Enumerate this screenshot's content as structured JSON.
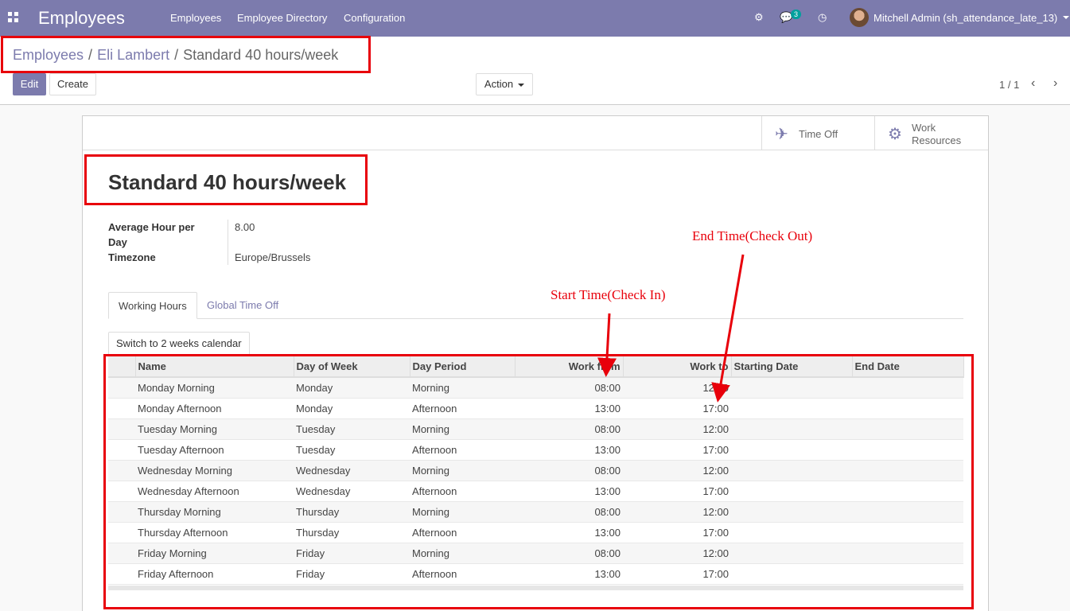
{
  "navbar": {
    "app_title": "Employees",
    "menu": [
      "Employees",
      "Employee Directory",
      "Configuration"
    ],
    "message_count": "3",
    "user": "Mitchell Admin (sh_attendance_late_13)"
  },
  "breadcrumb": {
    "items": [
      "Employees",
      "Eli Lambert"
    ],
    "current": "Standard 40 hours/week"
  },
  "buttons": {
    "edit": "Edit",
    "create": "Create",
    "action": "Action"
  },
  "pager": {
    "value": "1 / 1"
  },
  "smart_buttons": {
    "time_off": "Time Off",
    "work_resources_line1": "Work",
    "work_resources_line2": "Resources"
  },
  "form": {
    "title": "Standard 40 hours/week",
    "avg_hour_label_line1": "Average Hour per",
    "avg_hour_label_line2": "Day",
    "avg_hour_value": "8.00",
    "timezone_label": "Timezone",
    "timezone_value": "Europe/Brussels"
  },
  "tabs": [
    "Working Hours",
    "Global Time Off"
  ],
  "switch_button": "Switch to 2 weeks calendar",
  "table": {
    "columns": [
      "Name",
      "Day of Week",
      "Day Period",
      "Work from",
      "Work to",
      "Starting Date",
      "End Date"
    ],
    "rows": [
      [
        "Monday Morning",
        "Monday",
        "Morning",
        "08:00",
        "12:00"
      ],
      [
        "Monday Afternoon",
        "Monday",
        "Afternoon",
        "13:00",
        "17:00"
      ],
      [
        "Tuesday Morning",
        "Tuesday",
        "Morning",
        "08:00",
        "12:00"
      ],
      [
        "Tuesday Afternoon",
        "Tuesday",
        "Afternoon",
        "13:00",
        "17:00"
      ],
      [
        "Wednesday Morning",
        "Wednesday",
        "Morning",
        "08:00",
        "12:00"
      ],
      [
        "Wednesday Afternoon",
        "Wednesday",
        "Afternoon",
        "13:00",
        "17:00"
      ],
      [
        "Thursday Morning",
        "Thursday",
        "Morning",
        "08:00",
        "12:00"
      ],
      [
        "Thursday Afternoon",
        "Thursday",
        "Afternoon",
        "13:00",
        "17:00"
      ],
      [
        "Friday Morning",
        "Friday",
        "Morning",
        "08:00",
        "12:00"
      ],
      [
        "Friday Afternoon",
        "Friday",
        "Afternoon",
        "13:00",
        "17:00"
      ]
    ]
  },
  "annotations": {
    "start_time": "Start Time(Check In)",
    "end_time": "End Time(Check Out)",
    "color": "#e8000b"
  },
  "colors": {
    "brand": "#7c7bad",
    "annotation": "#e8000b"
  }
}
